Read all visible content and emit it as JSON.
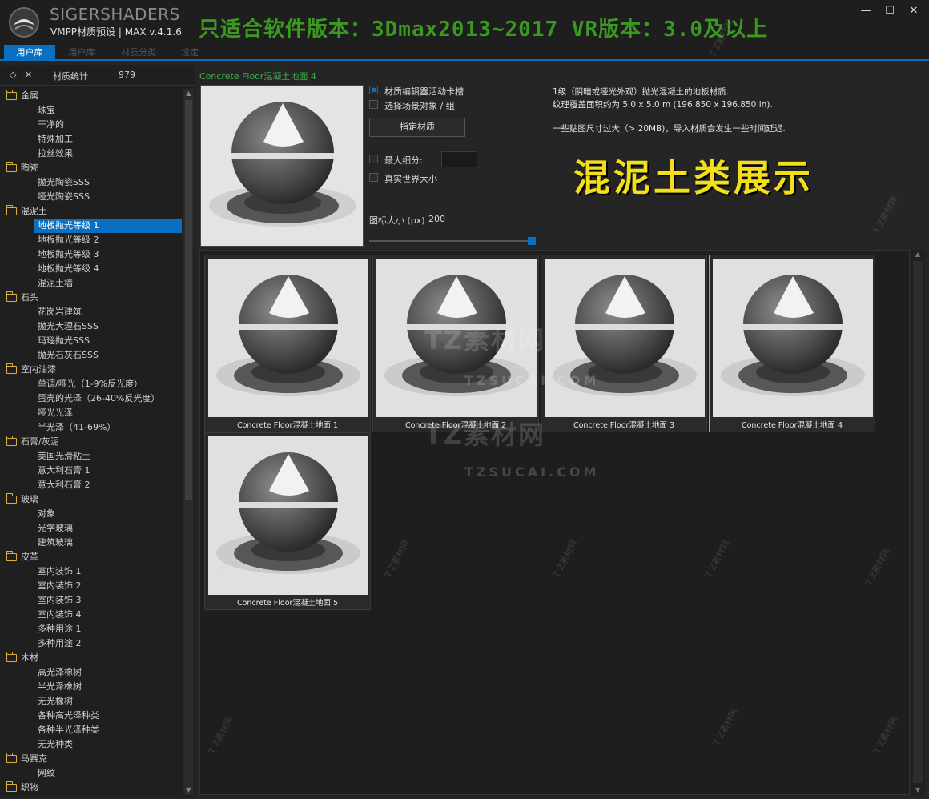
{
  "app": {
    "brand": "SIGERSHADERS",
    "subtitle": "VMPP材质预设 | MAX v.4.1.6",
    "banner": "只适合软件版本：3Dmax2013~2017  VR版本：3.0及以上",
    "window_controls": {
      "minimize": "—",
      "maximize": "☐",
      "close": "✕"
    }
  },
  "tabs": [
    {
      "label": "用户库",
      "active": true
    },
    {
      "label": "用户库",
      "active": false
    },
    {
      "label": "材质分类",
      "active": false
    },
    {
      "label": "设定",
      "active": false
    }
  ],
  "sidebar": {
    "header": {
      "icon1": "◇",
      "icon2": "✕",
      "label": "材质统计",
      "count": "979"
    },
    "tree": [
      {
        "type": "cat",
        "label": "金属"
      },
      {
        "type": "item",
        "label": "珠宝"
      },
      {
        "type": "item",
        "label": "干净的"
      },
      {
        "type": "item",
        "label": "特殊加工"
      },
      {
        "type": "item",
        "label": "拉丝效果"
      },
      {
        "type": "cat",
        "label": "陶瓷"
      },
      {
        "type": "item",
        "label": "抛光陶瓷SSS"
      },
      {
        "type": "item",
        "label": "哑光陶瓷SSS"
      },
      {
        "type": "cat",
        "label": "混泥土"
      },
      {
        "type": "item",
        "label": "地板抛光等级 1",
        "selected": true
      },
      {
        "type": "item",
        "label": "地板抛光等级 2"
      },
      {
        "type": "item",
        "label": "地板抛光等级 3"
      },
      {
        "type": "item",
        "label": "地板抛光等级 4"
      },
      {
        "type": "item",
        "label": "混泥土墙"
      },
      {
        "type": "cat",
        "label": "石头"
      },
      {
        "type": "item",
        "label": "花岗岩建筑"
      },
      {
        "type": "item",
        "label": "抛光大理石SSS"
      },
      {
        "type": "item",
        "label": "玛瑙抛光SSS"
      },
      {
        "type": "item",
        "label": "抛光石灰石SSS"
      },
      {
        "type": "cat",
        "label": "室内油漆"
      },
      {
        "type": "item",
        "label": "单调/哑光（1-9%反光度）"
      },
      {
        "type": "item",
        "label": "蛋壳的光泽（26-40%反光度）"
      },
      {
        "type": "item",
        "label": "哑光光泽"
      },
      {
        "type": "item",
        "label": "半光泽（41-69%）"
      },
      {
        "type": "cat",
        "label": "石膏/灰泥"
      },
      {
        "type": "item",
        "label": "美国光滑粘土"
      },
      {
        "type": "item",
        "label": "意大利石膏 1"
      },
      {
        "type": "item",
        "label": "意大利石膏 2"
      },
      {
        "type": "cat",
        "label": "玻璃"
      },
      {
        "type": "item",
        "label": "对象"
      },
      {
        "type": "item",
        "label": "光学玻璃"
      },
      {
        "type": "item",
        "label": "建筑玻璃"
      },
      {
        "type": "cat",
        "label": "皮革"
      },
      {
        "type": "item",
        "label": "室内装饰 1"
      },
      {
        "type": "item",
        "label": "室内装饰 2"
      },
      {
        "type": "item",
        "label": "室内装饰 3"
      },
      {
        "type": "item",
        "label": "室内装饰 4"
      },
      {
        "type": "item",
        "label": "多种用途 1"
      },
      {
        "type": "item",
        "label": "多种用途 2"
      },
      {
        "type": "cat",
        "label": "木材"
      },
      {
        "type": "item",
        "label": "高光泽橡树"
      },
      {
        "type": "item",
        "label": "半光泽橡树"
      },
      {
        "type": "item",
        "label": "无光橡树"
      },
      {
        "type": "item",
        "label": "各种高光泽种类"
      },
      {
        "type": "item",
        "label": "各种半光泽种类"
      },
      {
        "type": "item",
        "label": "无光种类"
      },
      {
        "type": "cat",
        "label": "马赛克"
      },
      {
        "type": "item",
        "label": "网纹"
      },
      {
        "type": "cat",
        "label": "织物"
      }
    ]
  },
  "detail": {
    "breadcrumb": "Concrete Floor混凝土地面 4",
    "options": {
      "editor_slot": {
        "label": "材质编辑器活动卡槽",
        "checked": true
      },
      "select_scene": {
        "label": "选择场景对象 / 组",
        "checked": false
      },
      "assign_button": "指定材质",
      "max_subdiv": {
        "label": "最大细分:",
        "checked": false,
        "value": ""
      },
      "real_world": {
        "label": "真实世界大小",
        "checked": false
      },
      "icon_size_label": "图标大小 (px)",
      "icon_size_value": "200",
      "icon_size_level": 1.0
    },
    "description_line1": "1级（阴暗或哑光外观）抛光混凝土的地板材质.",
    "description_line2": "纹理覆盖面积约为 5.0 x 5.0 m (196.850 x 196.850 in).",
    "description_line3": "一些贴图尺寸过大（> 20MB)，导入材质会发生一些时间延迟.",
    "showcase_text": "混泥土类展示"
  },
  "thumbnails": [
    {
      "caption": "Concrete Floor混凝土地面 1",
      "selected": false
    },
    {
      "caption": "Concrete Floor混凝土地面 2",
      "selected": false
    },
    {
      "caption": "Concrete Floor混凝土地面 3",
      "selected": false
    },
    {
      "caption": "Concrete Floor混凝土地面 4",
      "selected": true
    },
    {
      "caption": "Concrete Floor混凝土地面 5",
      "selected": false
    }
  ],
  "watermark": {
    "main": "TZ素材网",
    "sub": "TZSUCAI.COM",
    "small": "T Z素材网"
  },
  "colors": {
    "accent": "#0a6fc0",
    "banner": "#3a9a1f",
    "showcase": "#f2df1a",
    "breadcrumb": "#3cae4a",
    "folder": "#d6b13a",
    "selected_border": "#e0a62b"
  }
}
